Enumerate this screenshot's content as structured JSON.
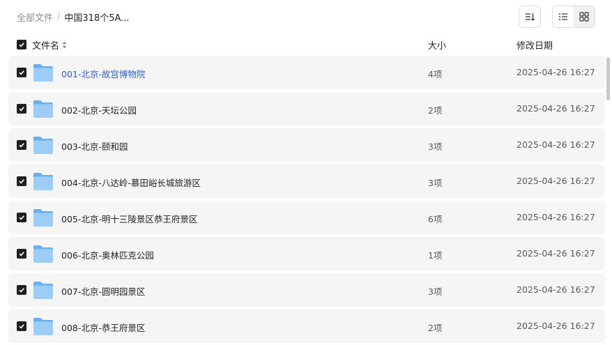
{
  "breadcrumb": {
    "root": "全部文件",
    "separator": "/",
    "current": "中国318个5A..."
  },
  "header": {
    "name": "文件名",
    "size": "大小",
    "date": "修改日期"
  },
  "colors": {
    "link": "#2b5fd9",
    "row_bg": "#f5f5f5",
    "checkbox": "#1f1f1f",
    "folder": "#8cc3f3"
  },
  "rows": [
    {
      "name": "001-北京-故宫博物院",
      "size": "4项",
      "date": "2025-04-26 16:27",
      "highlight": true
    },
    {
      "name": "002-北京-天坛公园",
      "size": "2项",
      "date": "2025-04-26 16:27"
    },
    {
      "name": "003-北京-颐和园",
      "size": "3项",
      "date": "2025-04-26 16:27"
    },
    {
      "name": "004-北京-八达岭-慕田峪长城旅游区",
      "size": "3项",
      "date": "2025-04-26 16:27"
    },
    {
      "name": "005-北京-明十三陵景区恭王府景区",
      "size": "6项",
      "date": "2025-04-26 16:27"
    },
    {
      "name": "006-北京-奥林匹克公园",
      "size": "1项",
      "date": "2025-04-26 16:27"
    },
    {
      "name": "007-北京-圆明园景区",
      "size": "3项",
      "date": "2025-04-26 16:27"
    },
    {
      "name": "008-北京-恭王府景区",
      "size": "2项",
      "date": "2025-04-26 16:27"
    }
  ]
}
